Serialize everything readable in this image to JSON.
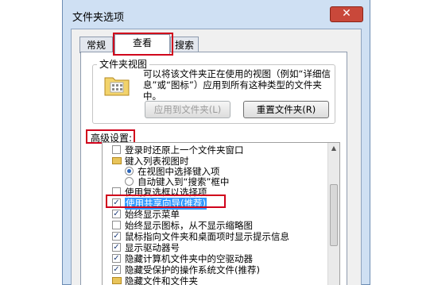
{
  "window": {
    "title": "文件夹选项",
    "close_glyph": "✕"
  },
  "tabs": [
    {
      "label": "常规"
    },
    {
      "label": "查看",
      "active": true
    },
    {
      "label": "搜索"
    }
  ],
  "folder_views": {
    "group_title": "文件夹视图",
    "description": "可以将该文件夹正在使用的视图（例如“详细信息”或“图标”）应用到所有这种类型的文件夹中。",
    "apply_button": "应用到文件夹(L)",
    "reset_button": "重置文件夹(R)"
  },
  "advanced": {
    "label": "高级设置:",
    "items": [
      {
        "type": "checkbox",
        "checked": false,
        "text": "登录时还原上一个文件夹窗口"
      },
      {
        "type": "folder",
        "text": "键入列表视图时"
      },
      {
        "type": "radio",
        "checked": true,
        "text": "在视图中选择键入项"
      },
      {
        "type": "radio",
        "checked": false,
        "text": "自动键入到“搜索”框中"
      },
      {
        "type": "checkbox",
        "checked": false,
        "text": "使用复选框以选择项"
      },
      {
        "type": "checkbox",
        "checked": true,
        "text": "使用共享向导(推荐)",
        "selected": true
      },
      {
        "type": "checkbox",
        "checked": true,
        "text": "始终显示菜单"
      },
      {
        "type": "checkbox",
        "checked": false,
        "text": "始终显示图标，从不显示缩略图"
      },
      {
        "type": "checkbox",
        "checked": true,
        "text": "鼠标指向文件夹和桌面项时显示提示信息"
      },
      {
        "type": "checkbox",
        "checked": true,
        "text": "显示驱动器号"
      },
      {
        "type": "checkbox",
        "checked": true,
        "text": "隐藏计算机文件夹中的空驱动器"
      },
      {
        "type": "checkbox",
        "checked": true,
        "text": "隐藏受保护的操作系统文件(推荐)"
      },
      {
        "type": "folder",
        "text": "隐藏文件和文件夹"
      }
    ]
  },
  "colors": {
    "highlight_box": "#d0021b",
    "selection": "#3399ff"
  }
}
